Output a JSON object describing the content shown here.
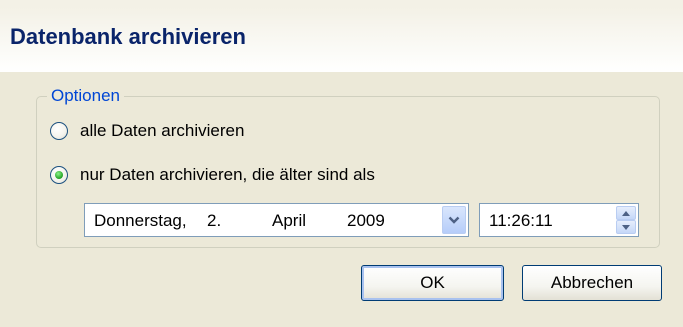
{
  "window": {
    "title": "Datenbank archivieren"
  },
  "options": {
    "legend": "Optionen",
    "radio_all": {
      "label": "alle Daten archivieren",
      "selected": false
    },
    "radio_older": {
      "label": "nur Daten archivieren, die älter sind als",
      "selected": true
    }
  },
  "date_picker": {
    "weekday": "Donnerstag,",
    "day": "2.",
    "month": "April",
    "year": "2009"
  },
  "time_picker": {
    "value": "11:26:11"
  },
  "buttons": {
    "ok": "OK",
    "cancel": "Abbrechen"
  },
  "colors": {
    "accent": "#0046d5",
    "title": "#0a246a",
    "radio_selected": "#21a121"
  },
  "icons": {
    "dropdown": "chevron-down-icon",
    "spin_up": "caret-up-icon",
    "spin_down": "caret-down-icon"
  }
}
